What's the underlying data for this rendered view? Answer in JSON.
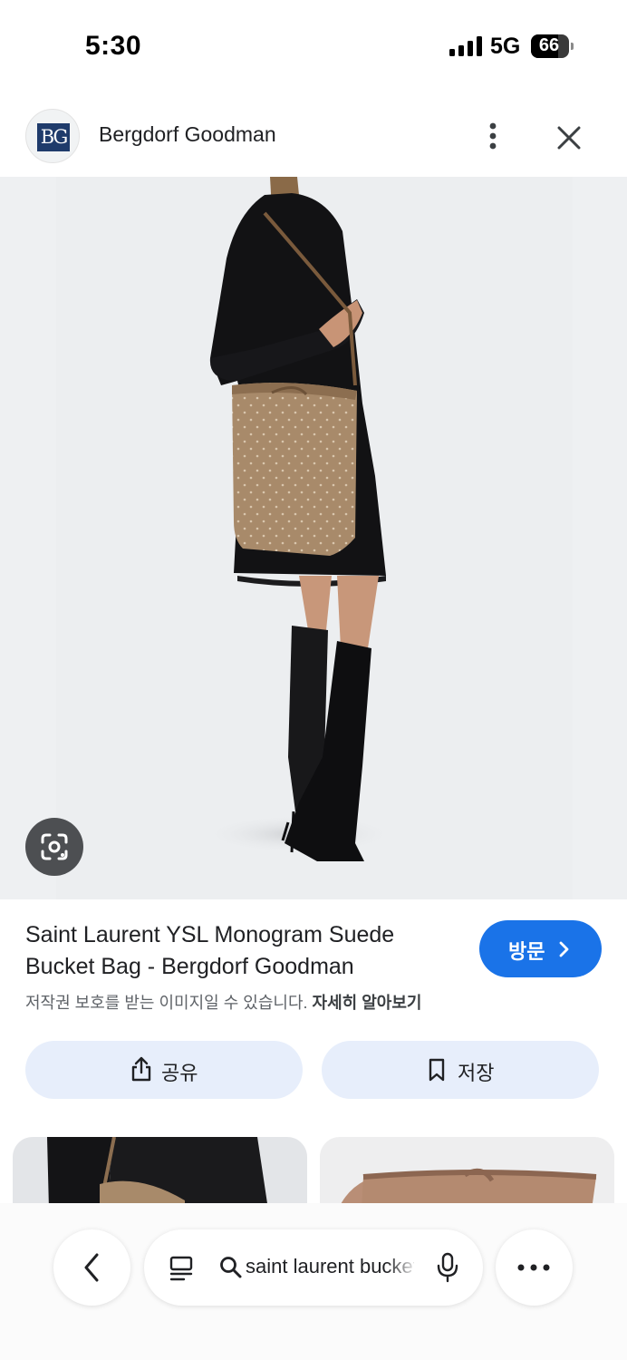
{
  "status_bar": {
    "time": "5:30",
    "network": "5G",
    "battery": "66"
  },
  "source": {
    "name": "Bergdorf Goodman",
    "logo_text": "BG"
  },
  "result": {
    "title": "Saint Laurent YSL Monogram Suede Bucket Bag - Bergdorf Goodman",
    "copyright_notice": "저작권 보호를 받는 이미지일 수 있습니다.",
    "learn_more": "자세히 알아보기",
    "visit_label": "방문"
  },
  "actions": {
    "share_label": "공유",
    "save_label": "저장"
  },
  "search": {
    "query": "saint laurent bucket bag"
  },
  "icons": [
    "bergdorf-goodman-logo",
    "more-vert-icon",
    "close-icon",
    "google-lens-icon",
    "chevron-right-icon",
    "share-icon",
    "bookmark-icon",
    "back-icon",
    "tabs-icon",
    "search-icon",
    "mic-icon",
    "more-horiz-icon"
  ],
  "colors": {
    "accent": "#1a73e8",
    "action_bg": "#e7eefb",
    "bag": "#a88a6a"
  }
}
